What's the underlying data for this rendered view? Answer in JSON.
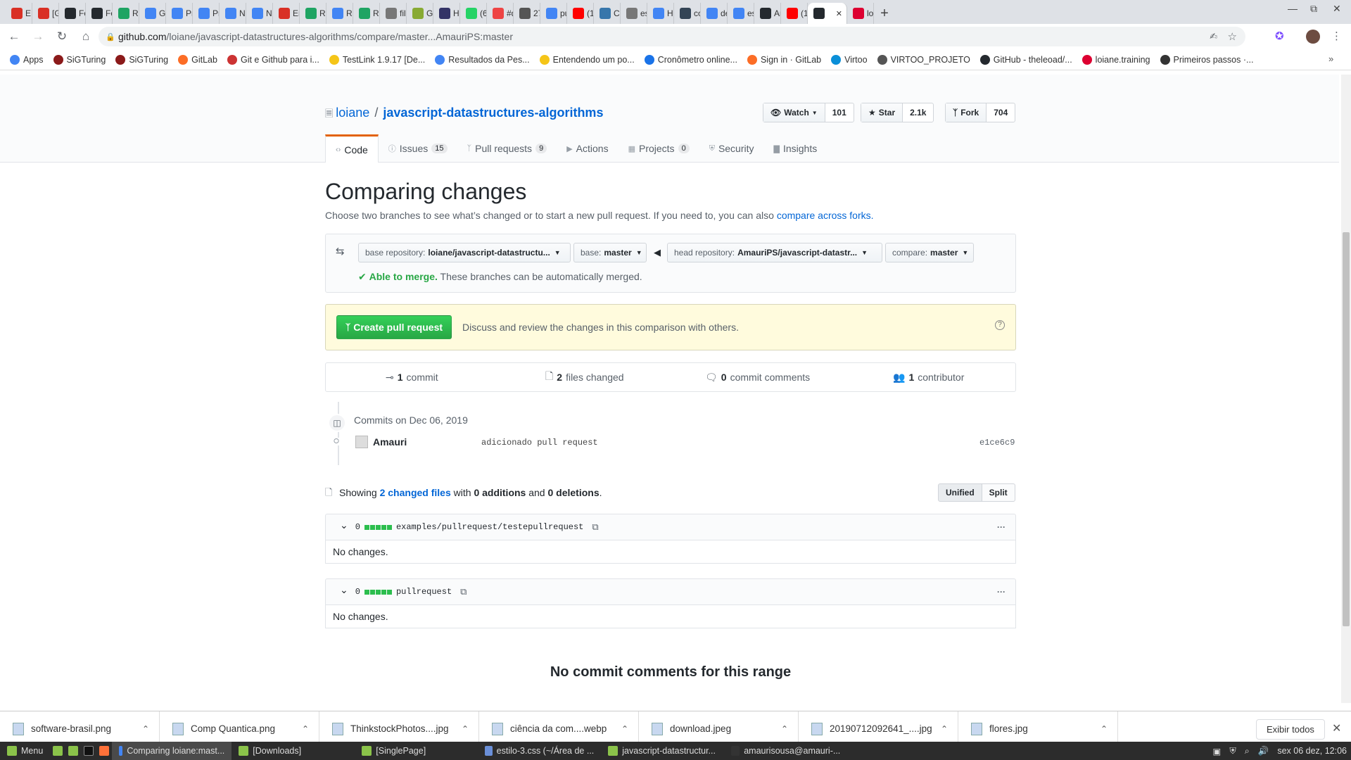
{
  "browser": {
    "tabs": [
      {
        "label": "EN",
        "icon": "gmail-icon",
        "color": "#d93025"
      },
      {
        "label": "[G",
        "icon": "gmail-icon",
        "color": "#d93025"
      },
      {
        "label": "Fo",
        "icon": "github-icon",
        "color": "#24292e"
      },
      {
        "label": "Fo",
        "icon": "github-icon",
        "color": "#24292e"
      },
      {
        "label": "Re",
        "icon": "drive-icon",
        "color": "#1fa463"
      },
      {
        "label": "Go",
        "icon": "google-icon",
        "color": "#4285f4"
      },
      {
        "label": "Pr",
        "icon": "docs-icon",
        "color": "#4285f4"
      },
      {
        "label": "Pr",
        "icon": "docs-icon",
        "color": "#4285f4"
      },
      {
        "label": "Nã",
        "icon": "google-icon",
        "color": "#4285f4"
      },
      {
        "label": "Nã",
        "icon": "google-icon",
        "color": "#4285f4"
      },
      {
        "label": "En",
        "icon": "gmail-icon",
        "color": "#d93025"
      },
      {
        "label": "Re",
        "icon": "drive-icon",
        "color": "#1fa463"
      },
      {
        "label": "Re",
        "icon": "docs-icon",
        "color": "#4285f4"
      },
      {
        "label": "Re",
        "icon": "drive-icon",
        "color": "#1fa463"
      },
      {
        "label": "file",
        "icon": "globe-icon",
        "color": "#777"
      },
      {
        "label": "Ge",
        "icon": "site-icon",
        "color": "#8a3"
      },
      {
        "label": "Hi",
        "icon": "site-icon",
        "color": "#336"
      },
      {
        "label": "(6)",
        "icon": "whatsapp-icon",
        "color": "#25d366"
      },
      {
        "label": "#d",
        "icon": "site-icon",
        "color": "#e44"
      },
      {
        "label": "27",
        "icon": "site-icon",
        "color": "#555"
      },
      {
        "label": "pu",
        "icon": "google-icon",
        "color": "#4285f4"
      },
      {
        "label": "(1",
        "icon": "youtube-icon",
        "color": "#f00"
      },
      {
        "label": "Co",
        "icon": "python-icon",
        "color": "#3776ab"
      },
      {
        "label": "es",
        "icon": "globe-icon",
        "color": "#777"
      },
      {
        "label": "Ha",
        "icon": "google-icon",
        "color": "#4285f4"
      },
      {
        "label": "co",
        "icon": "site-icon",
        "color": "#345"
      },
      {
        "label": "de",
        "icon": "google-icon",
        "color": "#4285f4"
      },
      {
        "label": "es",
        "icon": "google-icon",
        "color": "#4285f4"
      },
      {
        "label": "An",
        "icon": "github-icon",
        "color": "#24292e"
      },
      {
        "label": "(1",
        "icon": "youtube-icon",
        "color": "#f00"
      },
      {
        "label": "",
        "icon": "github-icon",
        "color": "#24292e",
        "active": true
      },
      {
        "label": "loi",
        "icon": "angular-icon",
        "color": "#dd0031"
      }
    ],
    "url_host": "github.com",
    "url_path": "/loiane/javascript-datastructures-algorithms/compare/master...AmauriPS:master",
    "bookmarks": [
      {
        "label": "Apps",
        "color": "#4285f4"
      },
      {
        "label": "SiGTuring",
        "color": "#8b1a1a"
      },
      {
        "label": "SiGTuring",
        "color": "#8b1a1a"
      },
      {
        "label": "GitLab",
        "color": "#fc6d26"
      },
      {
        "label": "Git e Github para i...",
        "color": "#c33"
      },
      {
        "label": "TestLink 1.9.17 [De...",
        "color": "#f5c518"
      },
      {
        "label": "Resultados da Pes...",
        "color": "#4285f4"
      },
      {
        "label": "Entendendo um po...",
        "color": "#f5c518"
      },
      {
        "label": "Cronômetro online...",
        "color": "#1a73e8"
      },
      {
        "label": "Sign in · GitLab",
        "color": "#fc6d26"
      },
      {
        "label": "Virtoo",
        "color": "#0a8fd8"
      },
      {
        "label": "VIRTOO_PROJETO",
        "color": "#555"
      },
      {
        "label": "GitHub - theleoad/...",
        "color": "#24292e"
      },
      {
        "label": "loiane.training",
        "color": "#dd0031"
      },
      {
        "label": "Primeiros passos ·...",
        "color": "#333"
      }
    ]
  },
  "repo": {
    "owner": "loiane",
    "separator": "/",
    "name": "javascript-datastructures-algorithms",
    "watch": {
      "label": "Watch",
      "count": "101"
    },
    "star": {
      "label": "Star",
      "count": "2.1k"
    },
    "fork": {
      "label": "Fork",
      "count": "704"
    },
    "tabs": [
      {
        "label": "Code",
        "count": null,
        "icon": "code-icon"
      },
      {
        "label": "Issues",
        "count": "15",
        "icon": "issue-icon"
      },
      {
        "label": "Pull requests",
        "count": "9",
        "icon": "pull-request-icon"
      },
      {
        "label": "Actions",
        "count": null,
        "icon": "play-icon"
      },
      {
        "label": "Projects",
        "count": "0",
        "icon": "project-icon"
      },
      {
        "label": "Security",
        "count": null,
        "icon": "shield-icon"
      },
      {
        "label": "Insights",
        "count": null,
        "icon": "graph-icon"
      }
    ]
  },
  "compare": {
    "title": "Comparing changes",
    "subtitle": "Choose two branches to see what’s changed or to start a new pull request. If you need to, you can also",
    "subtitle_link": "compare across forks.",
    "base_repo_label": "base repository:",
    "base_repo_value": "loiane/javascript-datastructu...",
    "base_label": "base:",
    "base_value": "master",
    "head_repo_label": "head repository:",
    "head_repo_value": "AmauriPS/javascript-datastr...",
    "compare_label": "compare:",
    "compare_value": "master",
    "merge_status": "Able to merge.",
    "merge_text": "These branches can be automatically merged.",
    "create_pr_label": "Create pull request",
    "create_pr_text": "Discuss and review the changes in this comparison with others."
  },
  "stats": {
    "commits_num": "1",
    "commits_label": "commit",
    "files_num": "2",
    "files_label": "files changed",
    "comments_num": "0",
    "comments_label": "commit comments",
    "contrib_num": "1",
    "contrib_label": "contributor"
  },
  "commits": {
    "date_header": "Commits on Dec 06, 2019",
    "items": [
      {
        "author": "Amauri",
        "message": "adicionado pull request",
        "sha": "e1ce6c9"
      }
    ]
  },
  "files": {
    "showing": "Showing",
    "changed_link": "2 changed files",
    "with": "with",
    "additions": "0 additions",
    "and": "and",
    "deletions": "0 deletions",
    "unified": "Unified",
    "split": "Split",
    "items": [
      {
        "count": "0",
        "path": "examples/pullrequest/testepullrequest",
        "body": "No changes."
      },
      {
        "count": "0",
        "path": "pullrequest",
        "body": "No changes."
      }
    ],
    "no_comments": "No commit comments for this range"
  },
  "downloads": {
    "items": [
      "software-brasil.png",
      "Comp Quantica.png",
      "ThinkstockPhotos....jpg",
      "ciência da com....webp",
      "download.jpeg",
      "20190712092641_....jpg",
      "flores.jpg"
    ],
    "show_all": "Exibir todos"
  },
  "taskbar": {
    "menu": "Menu",
    "items": [
      {
        "label": "Comparing loiane:mast...",
        "active": true,
        "color": "#4285f4"
      },
      {
        "label": "[Downloads]",
        "active": false,
        "color": "#8bc34a"
      },
      {
        "label": "[SinglePage]",
        "active": false,
        "color": "#8bc34a"
      },
      {
        "label": "estilo-3.css (~/Área de ...",
        "active": false,
        "color": "#6a8fd8"
      },
      {
        "label": "javascript-datastructur...",
        "active": false,
        "color": "#8bc34a"
      },
      {
        "label": "amaurisousa@amauri-...",
        "active": false,
        "color": "#333"
      }
    ],
    "clock": "sex 06 dez, 12:06"
  }
}
